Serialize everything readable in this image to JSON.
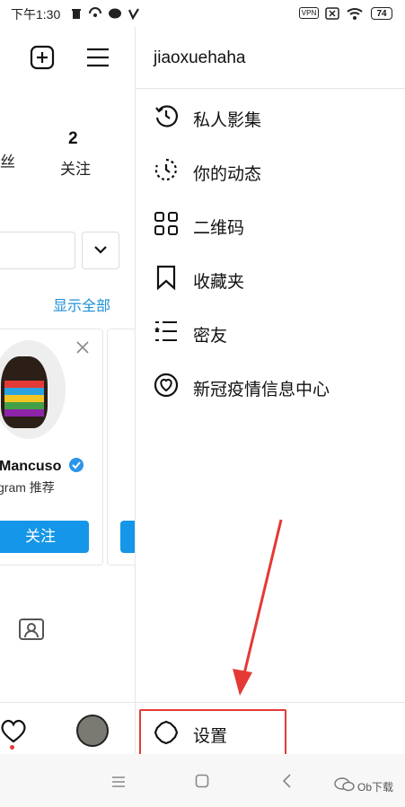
{
  "status_bar": {
    "time": "下午1:30",
    "vpn_label": "VPN",
    "battery": "74"
  },
  "profile_bg": {
    "following_count": "2",
    "following_label": "关注",
    "followers_label_partial": "丝",
    "show_all_link": "显示全部",
    "suggest_name_partial": "Mancuso",
    "suggest_source_partial": "gram 推荐",
    "follow_button_label": "关注"
  },
  "drawer": {
    "username": "jiaoxuehaha",
    "menu_items": [
      {
        "label": "私人影集",
        "icon": "archive-clock-icon"
      },
      {
        "label": "你的动态",
        "icon": "activity-icon"
      },
      {
        "label": "二维码",
        "icon": "qr-code-icon"
      },
      {
        "label": "收藏夹",
        "icon": "bookmark-icon"
      },
      {
        "label": "密友",
        "icon": "close-friends-icon"
      },
      {
        "label": "新冠疫情信息中心",
        "icon": "covid-info-icon"
      }
    ],
    "settings_label": "设置"
  },
  "watermark": "Ob下载",
  "colors": {
    "accent_blue": "#1596e8",
    "link_blue": "#1d8fd6",
    "annotation_red": "#e53935"
  }
}
